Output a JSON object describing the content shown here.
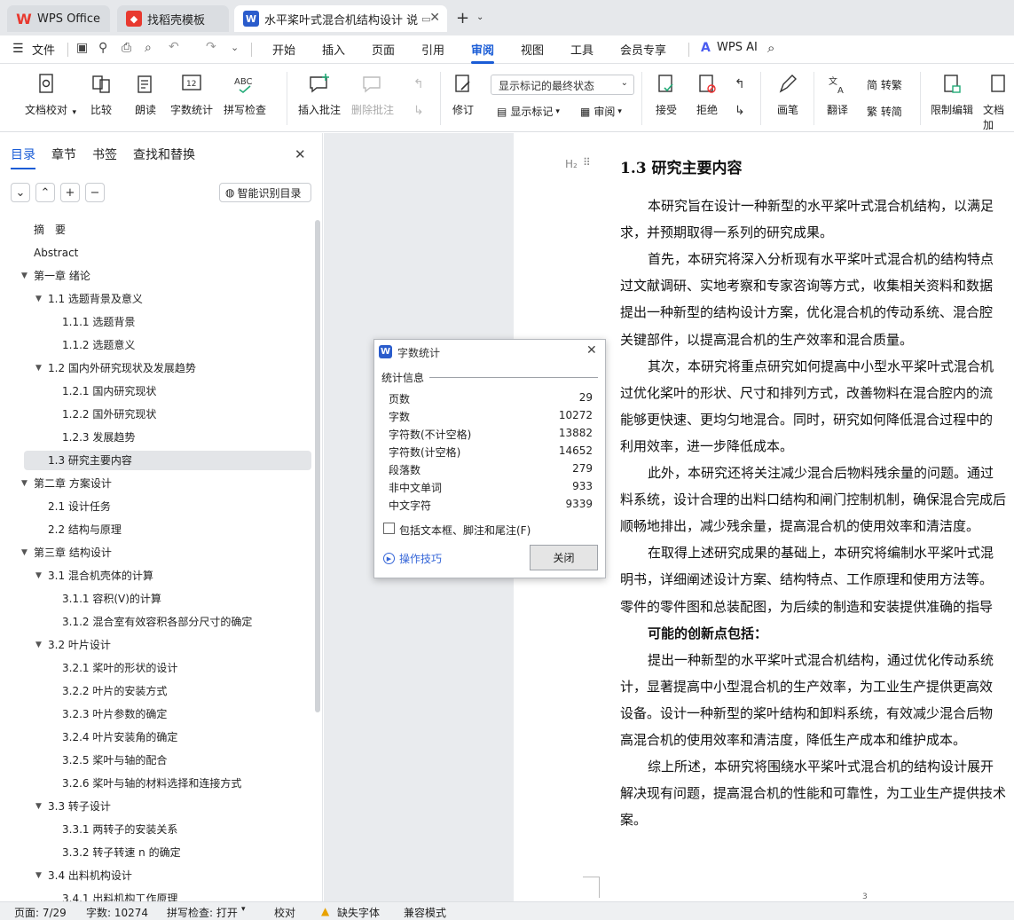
{
  "tabs": [
    {
      "label": "WPS Office",
      "icon": "wps-logo-icon",
      "color": "#e8392f"
    },
    {
      "label": "找稻壳模板",
      "icon": "docer-icon",
      "color": "#e8392f"
    },
    {
      "label": "水平桨叶式混合机结构设计 说",
      "icon": "word-doc-icon",
      "color": "#2a5ccc"
    }
  ],
  "menu": {
    "file": "文件",
    "items": [
      "开始",
      "插入",
      "页面",
      "引用",
      "审阅",
      "视图",
      "工具",
      "会员专享"
    ],
    "active": "审阅",
    "ai": "WPS AI"
  },
  "ribbon": {
    "doc_check": "文档校对",
    "compare": "比较",
    "read": "朗读",
    "word_count": "字数统计",
    "spell": "拼写检查",
    "insert_comment": "插入批注",
    "delete_comment": "删除批注",
    "revise": "修订",
    "markup_select": "显示标记的最终状态",
    "show_markup": "显示标记",
    "review": "审阅",
    "accept": "接受",
    "reject": "拒绝",
    "pen": "画笔",
    "translate": "翻译",
    "to_trad": "简 转繁",
    "to_simp": "繁 转简",
    "restrict": "限制编辑",
    "doc_encrypt": "文档加"
  },
  "nav": {
    "tabs": [
      "目录",
      "章节",
      "书签",
      "查找和替换"
    ],
    "smart": "智能识别目录",
    "items": [
      {
        "label": "摘　要",
        "level": 0,
        "caret": false
      },
      {
        "label": "Abstract",
        "level": 0,
        "caret": false
      },
      {
        "label": "第一章 绪论",
        "level": 0,
        "caret": true
      },
      {
        "label": "1.1 选题背景及意义",
        "level": 1,
        "caret": true
      },
      {
        "label": "1.1.1 选题背景",
        "level": 2,
        "caret": false
      },
      {
        "label": "1.1.2 选题意义",
        "level": 2,
        "caret": false
      },
      {
        "label": "1.2 国内外研究现状及发展趋势",
        "level": 1,
        "caret": true
      },
      {
        "label": "1.2.1 国内研究现状",
        "level": 2,
        "caret": false
      },
      {
        "label": "1.2.2 国外研究现状",
        "level": 2,
        "caret": false
      },
      {
        "label": "1.2.3 发展趋势",
        "level": 2,
        "caret": false
      },
      {
        "label": "1.3 研究主要内容",
        "level": 1,
        "caret": false,
        "selected": true
      },
      {
        "label": "第二章 方案设计",
        "level": 0,
        "caret": true
      },
      {
        "label": "2.1 设计任务",
        "level": 1,
        "caret": false
      },
      {
        "label": "2.2 结构与原理",
        "level": 1,
        "caret": false
      },
      {
        "label": "第三章 结构设计",
        "level": 0,
        "caret": true
      },
      {
        "label": "3.1 混合机壳体的计算",
        "level": 1,
        "caret": true
      },
      {
        "label": "3.1.1 容积(V)的计算",
        "level": 2,
        "caret": false
      },
      {
        "label": "3.1.2 混合室有效容积各部分尺寸的确定",
        "level": 2,
        "caret": false
      },
      {
        "label": "3.2 叶片设计",
        "level": 1,
        "caret": true
      },
      {
        "label": "3.2.1 桨叶的形状的设计",
        "level": 2,
        "caret": false
      },
      {
        "label": "3.2.2 叶片的安装方式",
        "level": 2,
        "caret": false
      },
      {
        "label": "3.2.3 叶片参数的确定",
        "level": 2,
        "caret": false
      },
      {
        "label": "3.2.4 叶片安装角的确定",
        "level": 2,
        "caret": false
      },
      {
        "label": "3.2.5 桨叶与轴的配合",
        "level": 2,
        "caret": false
      },
      {
        "label": "3.2.6 桨叶与轴的材料选择和连接方式",
        "level": 2,
        "caret": false
      },
      {
        "label": "3.3 转子设计",
        "level": 1,
        "caret": true
      },
      {
        "label": "3.3.1 两转子的安装关系",
        "level": 2,
        "caret": false
      },
      {
        "label": "3.3.2 转子转速 n 的确定",
        "level": 2,
        "caret": false
      },
      {
        "label": "3.4 出料机构设计",
        "level": 1,
        "caret": true
      },
      {
        "label": "3.4.1 出料机构工作原理",
        "level": 2,
        "caret": false
      }
    ]
  },
  "doc": {
    "heading_tag": "H₂",
    "heading": "1.3  研究主要内容",
    "lines": [
      {
        "text": "本研究旨在设计一种新型的水平桨叶式混合机结构，以满足",
        "indent": true
      },
      {
        "text": "求，并预期取得一系列的研究成果。",
        "indent": false
      },
      {
        "text": "首先，本研究将深入分析现有水平桨叶式混合机的结构特点",
        "indent": true
      },
      {
        "text": "过文献调研、实地考察和专家咨询等方式，收集相关资料和数据",
        "indent": false
      },
      {
        "text": "提出一种新型的结构设计方案，优化混合机的传动系统、混合腔",
        "indent": false
      },
      {
        "text": "关键部件，以提高混合机的生产效率和混合质量。",
        "indent": false
      },
      {
        "text": "其次，本研究将重点研究如何提高中小型水平桨叶式混合机",
        "indent": true
      },
      {
        "text": "过优化桨叶的形状、尺寸和排列方式，改善物料在混合腔内的流",
        "indent": false
      },
      {
        "text": "能够更快速、更均匀地混合。同时，研究如何降低混合过程中的",
        "indent": false
      },
      {
        "text": "利用效率，进一步降低成本。",
        "indent": false
      },
      {
        "text": "此外，本研究还将关注减少混合后物料残余量的问题。通过",
        "indent": true
      },
      {
        "text": "料系统，设计合理的出料口结构和闸门控制机制，确保混合完成后",
        "indent": false
      },
      {
        "text": "顺畅地排出，减少残余量，提高混合机的使用效率和清洁度。",
        "indent": false
      },
      {
        "text": "在取得上述研究成果的基础上，本研究将编制水平桨叶式混",
        "indent": true
      },
      {
        "text": "明书，详细阐述设计方案、结构特点、工作原理和使用方法等。",
        "indent": false
      },
      {
        "text": "零件的零件图和总装配图，为后续的制造和安装提供准确的指导",
        "indent": false
      },
      {
        "text": "可能的创新点包括：",
        "indent": true,
        "bold": true
      },
      {
        "text": "提出一种新型的水平桨叶式混合机结构，通过优化传动系统",
        "indent": true
      },
      {
        "text": "计，显著提高中小型混合机的生产效率，为工业生产提供更高效",
        "indent": false
      },
      {
        "text": "设备。设计一种新型的桨叶结构和卸料系统，有效减少混合后物",
        "indent": false
      },
      {
        "text": "高混合机的使用效率和清洁度，降低生产成本和维护成本。",
        "indent": false
      },
      {
        "text": "综上所述，本研究将围绕水平桨叶式混合机的结构设计展开",
        "indent": true
      },
      {
        "text": "解决现有问题，提高混合机的性能和可靠性，为工业生产提供技术",
        "indent": false
      },
      {
        "text": "案。",
        "indent": false
      }
    ],
    "page_number": "3"
  },
  "dialog": {
    "title": "字数统计",
    "section": "统计信息",
    "rows": [
      {
        "label": "页数",
        "value": "29"
      },
      {
        "label": "字数",
        "value": "10272"
      },
      {
        "label": "字符数(不计空格)",
        "value": "13882"
      },
      {
        "label": "字符数(计空格)",
        "value": "14652"
      },
      {
        "label": "段落数",
        "value": "279"
      },
      {
        "label": "非中文单词",
        "value": "933"
      },
      {
        "label": "中文字符",
        "value": "9339"
      }
    ],
    "checkbox": "包括文本框、脚注和尾注(F)",
    "tips": "操作技巧",
    "close": "关闭"
  },
  "status": {
    "page": "页面: 7/29",
    "words": "字数: 10274",
    "spell": "拼写检查: 打开",
    "proof": "校对",
    "font": "缺失字体",
    "compat": "兼容模式"
  }
}
